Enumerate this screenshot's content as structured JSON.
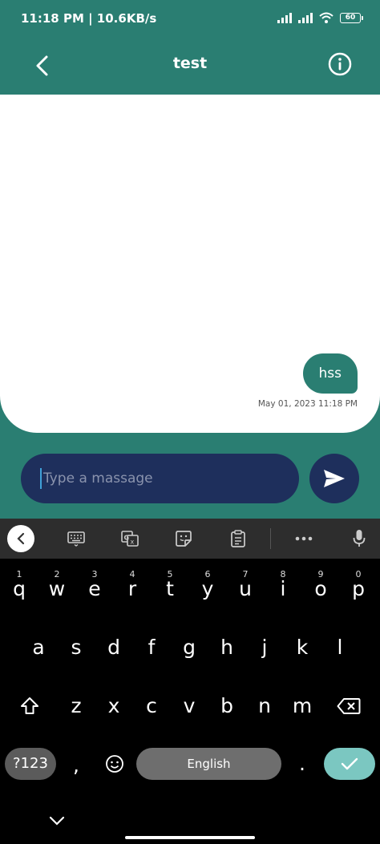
{
  "status_bar": {
    "time_speed": "11:18 PM | 10.6KB/s",
    "battery": "60"
  },
  "header": {
    "title": "test"
  },
  "chat": {
    "messages": [
      {
        "text": "hss",
        "timestamp": "May 01, 2023 11:18 PM",
        "sender": "me"
      }
    ]
  },
  "composer": {
    "placeholder": "Type a massage",
    "value": ""
  },
  "keyboard": {
    "row1": [
      {
        "char": "q",
        "num": "1"
      },
      {
        "char": "w",
        "num": "2"
      },
      {
        "char": "e",
        "num": "3"
      },
      {
        "char": "r",
        "num": "4"
      },
      {
        "char": "t",
        "num": "5"
      },
      {
        "char": "y",
        "num": "6"
      },
      {
        "char": "u",
        "num": "7"
      },
      {
        "char": "i",
        "num": "8"
      },
      {
        "char": "o",
        "num": "9"
      },
      {
        "char": "p",
        "num": "0"
      }
    ],
    "row2": [
      "a",
      "s",
      "d",
      "f",
      "g",
      "h",
      "j",
      "k",
      "l"
    ],
    "row3": [
      "z",
      "x",
      "c",
      "v",
      "b",
      "n",
      "m"
    ],
    "num_label": "?123",
    "comma": ",",
    "space_label": "English",
    "period": "."
  },
  "colors": {
    "primary": "#2a7e72",
    "composer": "#1e2f5c",
    "enter_key": "#7bc7c1"
  }
}
